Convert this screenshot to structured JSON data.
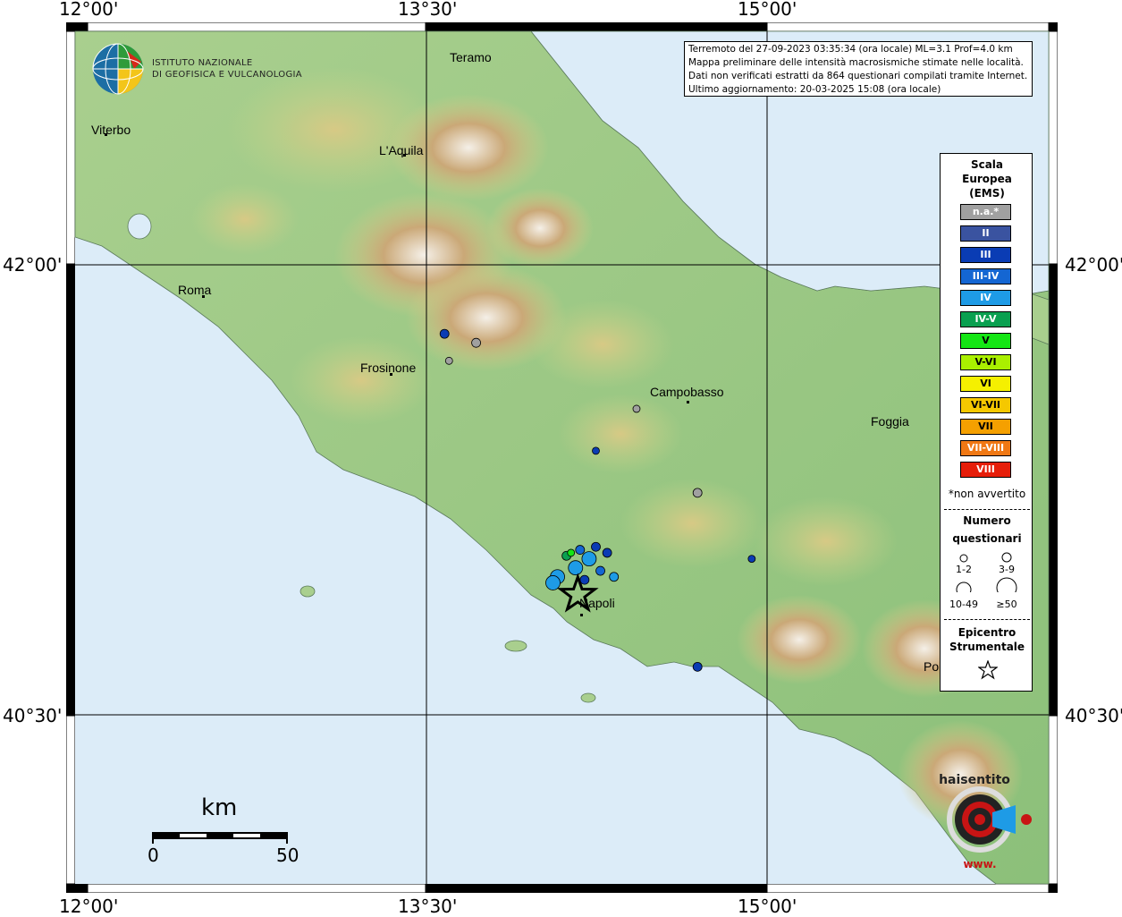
{
  "coords": {
    "top": [
      "12°00'",
      "13°30'",
      "15°00'"
    ],
    "bottom": [
      "12°00'",
      "13°30'",
      "15°00'"
    ],
    "left": [
      "42°00'",
      "40°30'"
    ],
    "right": [
      "42°00'",
      "40°30'"
    ]
  },
  "info": {
    "line1": "Terremoto del 27-09-2023 03:35:34 (ora locale) ML=3.1 Prof=4.0 km",
    "line2": "Mappa preliminare delle intensità macrosismiche stimate nelle località.",
    "line3": "Dati non verificati estratti da 864 questionari compilati tramite Internet.",
    "line4": "Ultimo aggiornamento: 20-03-2025 15:08 (ora locale)"
  },
  "logo": {
    "line1": "ISTITUTO NAZIONALE",
    "line2": "DI GEOFISICA E VULCANOLOGIA"
  },
  "places": {
    "teramo": "Teramo",
    "viterbo": "Viterbo",
    "laquila": "L'Aquila",
    "roma": "Roma",
    "frosinone": "Frosinone",
    "campobasso": "Campobasso",
    "foggia": "Foggia",
    "napoli": "Napoli",
    "potenza": "Po"
  },
  "legend": {
    "title1": "Scala",
    "title2": "Europea",
    "title3": "(EMS)",
    "levels": [
      {
        "label": "n.a.*",
        "color": "#a0a0a0"
      },
      {
        "label": "II",
        "color": "#3a53a0"
      },
      {
        "label": "III",
        "color": "#0a3cb4"
      },
      {
        "label": "III-IV",
        "color": "#1466d2"
      },
      {
        "label": "IV",
        "color": "#1e9be6"
      },
      {
        "label": "IV-V",
        "color": "#0aa050"
      },
      {
        "label": "V",
        "color": "#14e614"
      },
      {
        "label": "V-VI",
        "color": "#aaf000"
      },
      {
        "label": "VI",
        "color": "#f5f000"
      },
      {
        "label": "VI-VII",
        "color": "#f5c800"
      },
      {
        "label": "VII",
        "color": "#f5a000"
      },
      {
        "label": "VII-VIII",
        "color": "#f07814"
      },
      {
        "label": "VIII",
        "color": "#e61e0a"
      }
    ],
    "note": "*non avvertito",
    "count_title1": "Numero",
    "count_title2": "questionari",
    "sizes": [
      "1-2",
      "3-9",
      "10-49",
      "≥50"
    ],
    "epi_title1": "Epicentro",
    "epi_title2": "Strumentale"
  },
  "scale": {
    "unit": "km",
    "min": "0",
    "max": "50"
  },
  "points": [
    {
      "lon": 13.58,
      "lat": 41.77,
      "ems": "III",
      "n": "3-9"
    },
    {
      "lon": 13.72,
      "lat": 41.74,
      "ems": "n.a.*",
      "n": "3-9"
    },
    {
      "lon": 14.18,
      "lat": 41.05,
      "ems": "III-IV",
      "n": "3-9"
    },
    {
      "lon": 14.25,
      "lat": 41.06,
      "ems": "III",
      "n": "3-9"
    },
    {
      "lon": 14.22,
      "lat": 41.02,
      "ems": "IV",
      "n": "10-49"
    },
    {
      "lon": 14.16,
      "lat": 40.99,
      "ems": "IV",
      "n": "10-49"
    },
    {
      "lon": 14.08,
      "lat": 40.96,
      "ems": "IV",
      "n": "10-49"
    },
    {
      "lon": 14.06,
      "lat": 40.94,
      "ems": "IV",
      "n": "10-49"
    },
    {
      "lon": 14.2,
      "lat": 40.95,
      "ems": "III",
      "n": "3-9"
    },
    {
      "lon": 14.27,
      "lat": 40.98,
      "ems": "III-IV",
      "n": "3-9"
    },
    {
      "lon": 14.3,
      "lat": 41.04,
      "ems": "III",
      "n": "3-9"
    },
    {
      "lon": 14.33,
      "lat": 40.96,
      "ems": "IV",
      "n": "3-9"
    },
    {
      "lon": 14.12,
      "lat": 41.03,
      "ems": "IV-V",
      "n": "3-9"
    },
    {
      "lon": 14.14,
      "lat": 41.04,
      "ems": "V",
      "n": "1-2"
    },
    {
      "lon": 14.7,
      "lat": 40.66,
      "ems": "III",
      "n": "3-9"
    },
    {
      "lon": 14.94,
      "lat": 41.02,
      "ems": "III",
      "n": "1-2"
    },
    {
      "lon": 14.25,
      "lat": 41.38,
      "ems": "III",
      "n": "1-2"
    },
    {
      "lon": 14.7,
      "lat": 41.24,
      "ems": "n.a.*",
      "n": "3-9"
    },
    {
      "lon": 13.6,
      "lat": 41.68,
      "ems": "n.a.*",
      "n": "1-2"
    },
    {
      "lon": 14.43,
      "lat": 41.52,
      "ems": "n.a.*",
      "n": "1-2"
    }
  ],
  "epicenter": {
    "lon": 14.17,
    "lat": 40.9
  }
}
